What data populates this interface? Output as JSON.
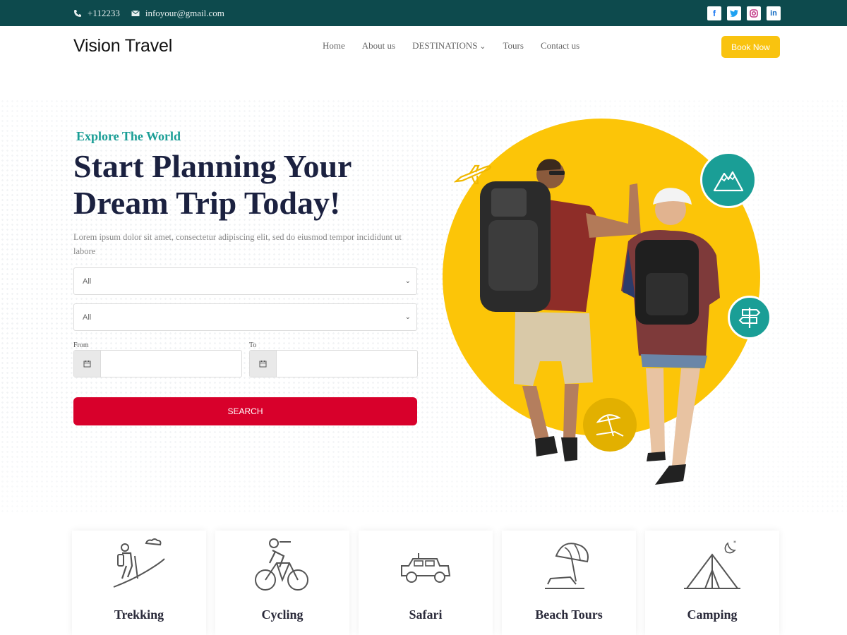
{
  "topbar": {
    "phone": "+112233",
    "email": "infoyour@gmail.com",
    "socials": [
      {
        "name": "facebook",
        "glyph": "f",
        "color": "#1877f2"
      },
      {
        "name": "twitter",
        "glyph": "t",
        "color": "#1da1f2"
      },
      {
        "name": "instagram",
        "glyph": "◎",
        "color": "#c13584"
      },
      {
        "name": "linkedin",
        "glyph": "in",
        "color": "#0a66c2"
      }
    ]
  },
  "header": {
    "logo": "Vision Travel",
    "nav": [
      "Home",
      "About us",
      "DESTINATIONS",
      "Tours",
      "Contact us"
    ],
    "book_label": "Book Now"
  },
  "hero": {
    "kicker": "Explore The World",
    "headline_line1": "Start Planning Your",
    "headline_line2": "Dream Trip Today!",
    "lorem": "Lorem ipsum dolor sit amet, consectetur adipiscing elit, sed do eiusmod tempor incididunt ut labore"
  },
  "form": {
    "select1_value": "All",
    "select2_value": "All",
    "from_label": "From",
    "to_label": "To",
    "search_label": "SEARCH"
  },
  "categories": [
    {
      "label": "Trekking",
      "icon": "trekking-icon"
    },
    {
      "label": "Cycling",
      "icon": "cycling-icon"
    },
    {
      "label": "Safari",
      "icon": "safari-jeep-icon"
    },
    {
      "label": "Beach Tours",
      "icon": "beach-umbrella-icon"
    },
    {
      "label": "Camping",
      "icon": "tent-icon"
    }
  ],
  "colors": {
    "topbar": "#0d4a4d",
    "accent_yellow": "#fcc508",
    "accent_teal": "#1a9e96",
    "search_red": "#d8002b"
  }
}
